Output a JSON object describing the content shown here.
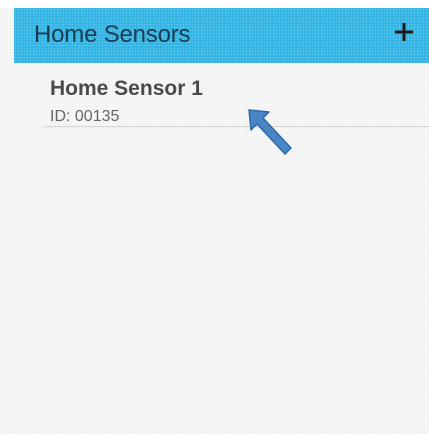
{
  "app_bar": {
    "title": "Home Sensors",
    "add_icon": "plus-icon",
    "color": "#33b5e5"
  },
  "sensors": [
    {
      "name": "Home Sensor 1",
      "id_text": "ID: 00135"
    }
  ],
  "annotation": {
    "icon": "pointer-arrow-icon",
    "color": "#4a86c5"
  }
}
